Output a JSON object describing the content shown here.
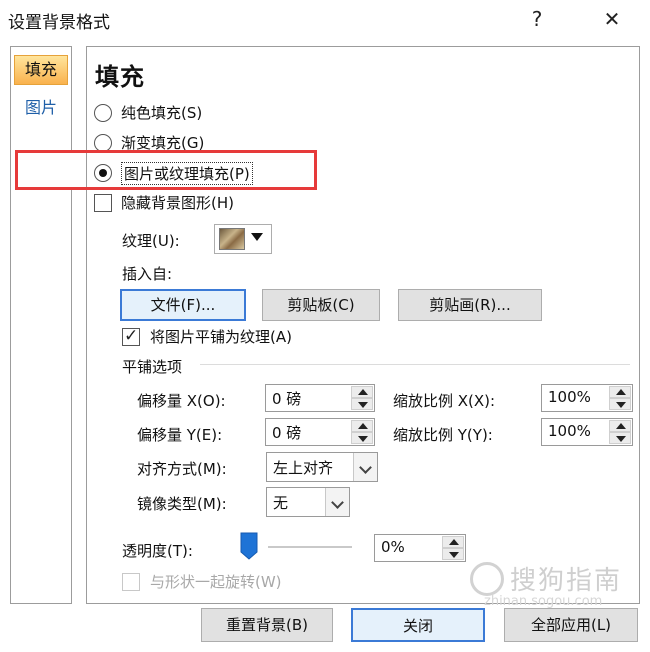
{
  "window": {
    "title": "设置背景格式",
    "help_icon": "?",
    "close_icon": "✕"
  },
  "nav": {
    "items": [
      {
        "label": "填充",
        "selected": true
      },
      {
        "label": "图片",
        "selected": false
      }
    ]
  },
  "fill": {
    "section_title": "填充",
    "options": [
      {
        "label": "纯色填充(S)",
        "checked": false
      },
      {
        "label": "渐变填充(G)",
        "checked": false
      },
      {
        "label": "图片或纹理填充(P)",
        "checked": true
      }
    ],
    "hide_background_label": "隐藏背景图形(H)",
    "texture_label": "纹理(U):",
    "insert_from_label": "插入自:",
    "file_button": "文件(F)...",
    "clipboard_button": "剪贴板(C)",
    "clipart_button": "剪贴画(R)...",
    "tile_label": "将图片平铺为纹理(A)",
    "tile_checked": true,
    "tile_options_label": "平铺选项",
    "offset_x_label": "偏移量 X(O):",
    "offset_x_value": "0 磅",
    "offset_y_label": "偏移量 Y(E):",
    "offset_y_value": "0 磅",
    "scale_x_label": "缩放比例 X(X):",
    "scale_x_value": "100%",
    "scale_y_label": "缩放比例 Y(Y):",
    "scale_y_value": "100%",
    "alignment_label": "对齐方式(M):",
    "alignment_value": "左上对齐",
    "mirror_label": "镜像类型(M):",
    "mirror_value": "无",
    "transparency_label": "透明度(T):",
    "transparency_value": "0%",
    "transparency_level": 0,
    "rotate_with_shape_label": "与形状一起旋转(W)"
  },
  "footer": {
    "reset_button": "重置背景(B)",
    "close_button": "关闭",
    "apply_all_button": "全部应用(L)"
  },
  "watermark": {
    "text": "搜狗指南",
    "sub": "zhinan.sogou.com"
  },
  "colors": {
    "highlight_border": "#e63a3a",
    "nav_selected": "#f9b24e"
  }
}
